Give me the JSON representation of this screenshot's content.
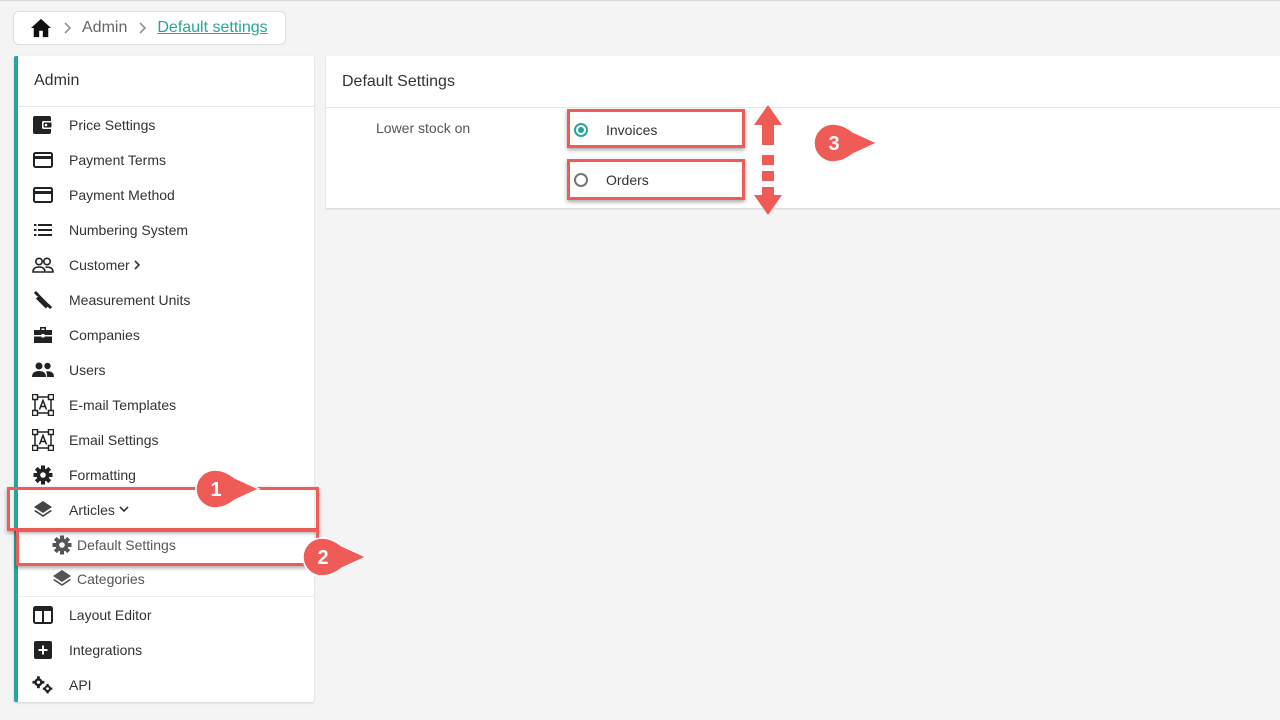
{
  "breadcrumb": {
    "home_icon": "home-icon",
    "items": [
      "Admin",
      "Default settings"
    ]
  },
  "sidebar": {
    "title": "Admin",
    "items": [
      {
        "label": "Price Settings",
        "icon": "wallet-icon"
      },
      {
        "label": "Payment Terms",
        "icon": "credit-card-icon"
      },
      {
        "label": "Payment Method",
        "icon": "credit-card-icon"
      },
      {
        "label": "Numbering System",
        "icon": "list-icon"
      },
      {
        "label": "Customer",
        "icon": "people-outline-icon"
      },
      {
        "label": "Measurement Units",
        "icon": "ruler-icon"
      },
      {
        "label": "Companies",
        "icon": "briefcase-icon"
      },
      {
        "label": "Users",
        "icon": "people-icon"
      },
      {
        "label": "E-mail Templates",
        "icon": "text-box-icon"
      },
      {
        "label": "Email Settings",
        "icon": "text-box-icon"
      },
      {
        "label": "Formatting",
        "icon": "gear-icon"
      },
      {
        "label": "Articles",
        "icon": "layers-icon"
      },
      {
        "label": "Default Settings",
        "icon": "gear-icon"
      },
      {
        "label": "Categories",
        "icon": "layers-icon"
      },
      {
        "label": "Layout Editor",
        "icon": "layout-icon"
      },
      {
        "label": "Integrations",
        "icon": "plus-box-icon"
      },
      {
        "label": "API",
        "icon": "gears-icon"
      }
    ]
  },
  "card": {
    "title": "Default Settings",
    "field_label": "Lower stock on",
    "options": [
      {
        "label": "Invoices",
        "checked": true
      },
      {
        "label": "Orders",
        "checked": false
      }
    ]
  },
  "annotations": {
    "badges": [
      "1",
      "2",
      "3"
    ],
    "color": "#ef5b56"
  },
  "colors": {
    "accent": "#26a69a",
    "annotation": "#ef5b56"
  }
}
